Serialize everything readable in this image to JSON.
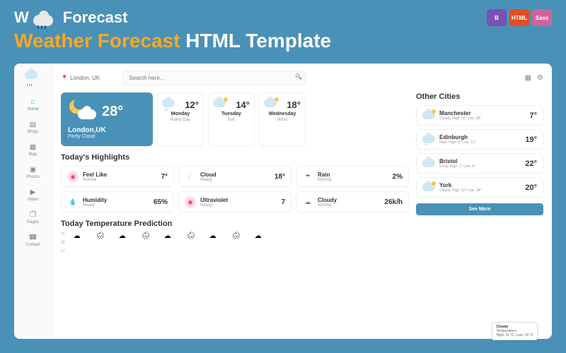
{
  "banner": {
    "logo": "W",
    "logo2": "Forecast",
    "title_1": "Weather Forecast",
    "title_2": " HTML Template",
    "badges": {
      "b": "B",
      "html": "HTML",
      "sass": "Sass"
    }
  },
  "topbar": {
    "location": "London, UK",
    "search_placeholder": "Search here..."
  },
  "sidebar": {
    "items": [
      {
        "label": "Home"
      },
      {
        "label": "Blogs"
      },
      {
        "label": "Map"
      },
      {
        "label": "Photos"
      },
      {
        "label": "Video"
      },
      {
        "label": "Pages"
      },
      {
        "label": "Contact"
      }
    ]
  },
  "current": {
    "location": "London,UK",
    "desc": "Partly Cloud",
    "temp": "28°"
  },
  "forecast": [
    {
      "day": "Monday",
      "desc": "Rainy Day",
      "temp": "12°"
    },
    {
      "day": "Tuesday",
      "desc": "Sun",
      "temp": "14°"
    },
    {
      "day": "Wednesday",
      "desc": "Wind",
      "temp": "18°"
    }
  ],
  "highlights_title": "Today's Highlights",
  "highlights": [
    {
      "name": "Feel Like",
      "desc": "Normal",
      "val": "7°"
    },
    {
      "name": "Cloud",
      "desc": "Heavy",
      "val": "18°"
    },
    {
      "name": "Rain",
      "desc": "Normal",
      "val": "2%"
    },
    {
      "name": "Humidity",
      "desc": "Heavy",
      "val": "65%"
    },
    {
      "name": "Ultraviolet",
      "desc": "Heavy",
      "val": "7"
    },
    {
      "name": "Cloudy",
      "desc": "Normal",
      "val": "26k/h"
    }
  ],
  "cities_title": "Other Cities",
  "cities": [
    {
      "name": "Manchester",
      "desc": "Cloudy. High: 11° Low: 18°",
      "temp": "7°"
    },
    {
      "name": "Edinburgh",
      "desc": "Rain. High: 8° Low: 12°",
      "temp": "19°"
    },
    {
      "name": "Bristol",
      "desc": "Snow. High: 2° Low: 8°",
      "temp": "22°"
    },
    {
      "name": "York",
      "desc": "Cloudy. High: 10° Low: 18°",
      "temp": "20°"
    }
  ],
  "see_more": "See More",
  "prediction_title": "Today Temperature Prediction",
  "axis": {
    "unit": "°C",
    "v1": "20",
    "v2": "17"
  },
  "tooltip": {
    "title": "Cloudy",
    "line1": "Temperature:",
    "line2": "High: 11 °C, Low: 18 °C"
  }
}
